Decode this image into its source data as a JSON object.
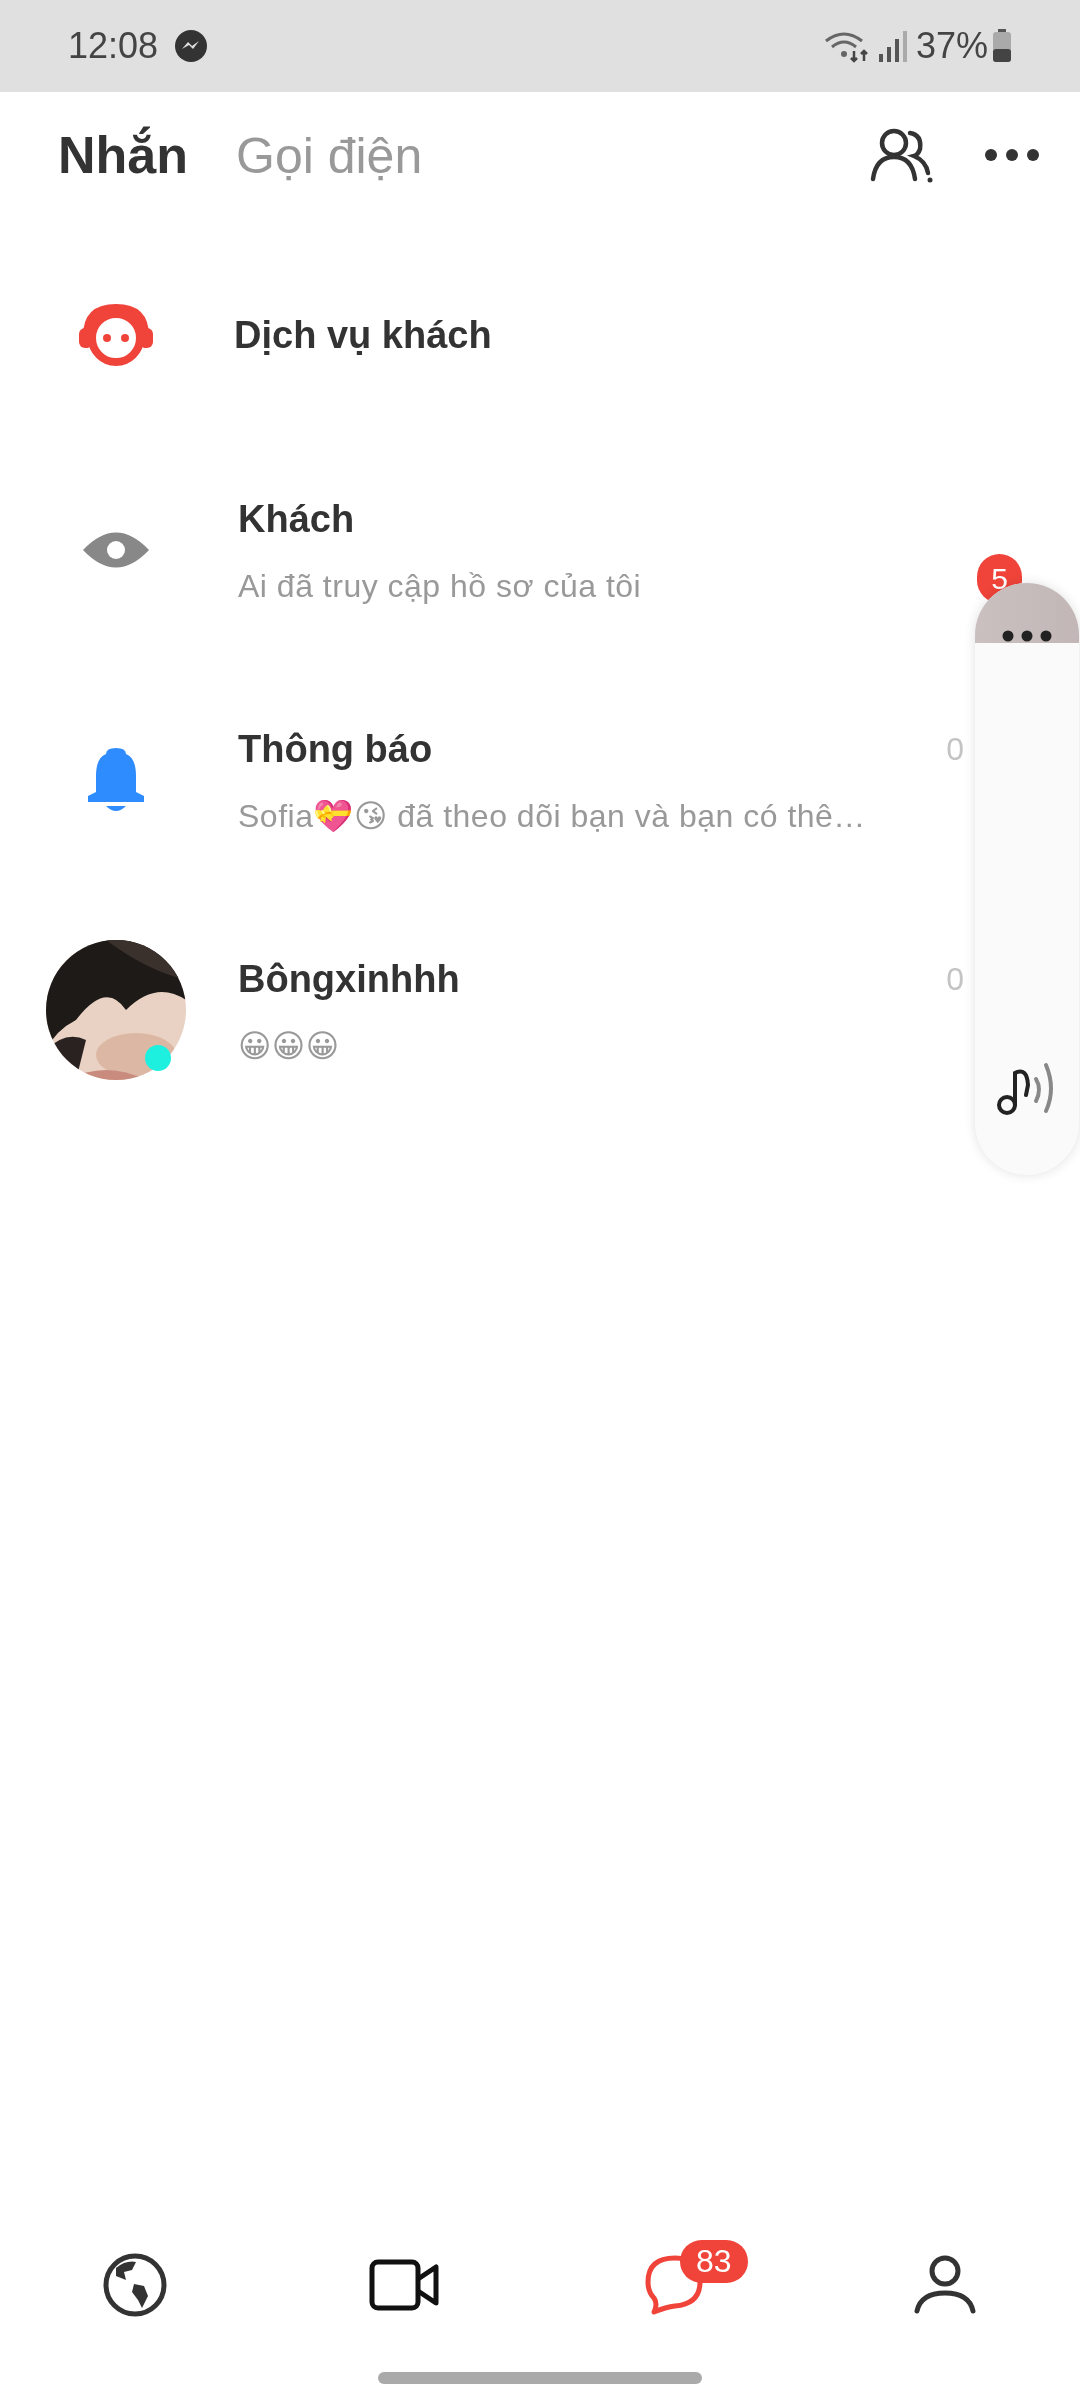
{
  "status_bar": {
    "time": "12:08",
    "battery": "37%"
  },
  "tabs": [
    {
      "label": "Nhắn",
      "selected": true
    },
    {
      "label": "Gọi điện",
      "selected": false
    }
  ],
  "conversations": [
    {
      "kind": "service",
      "title": "Dịch vụ khách"
    },
    {
      "kind": "visitor",
      "title": "Khách",
      "subtitle": "Ai đã truy cập hồ sơ của tôi",
      "badge": "5"
    },
    {
      "kind": "notification",
      "title": "Thông báo",
      "subtitle": "Sofia💝😘 đã theo dõi bạn và bạn có thê…",
      "time": "0"
    },
    {
      "kind": "contact",
      "title": "Bôngxinhhh",
      "subtitle": "😀😀😀",
      "time": "0",
      "online": true
    }
  ],
  "bottom_nav": [
    {
      "kind": "globe",
      "selected": false
    },
    {
      "kind": "video",
      "selected": false
    },
    {
      "kind": "chat",
      "selected": true,
      "badge": "83"
    },
    {
      "kind": "profile",
      "selected": false
    }
  ]
}
